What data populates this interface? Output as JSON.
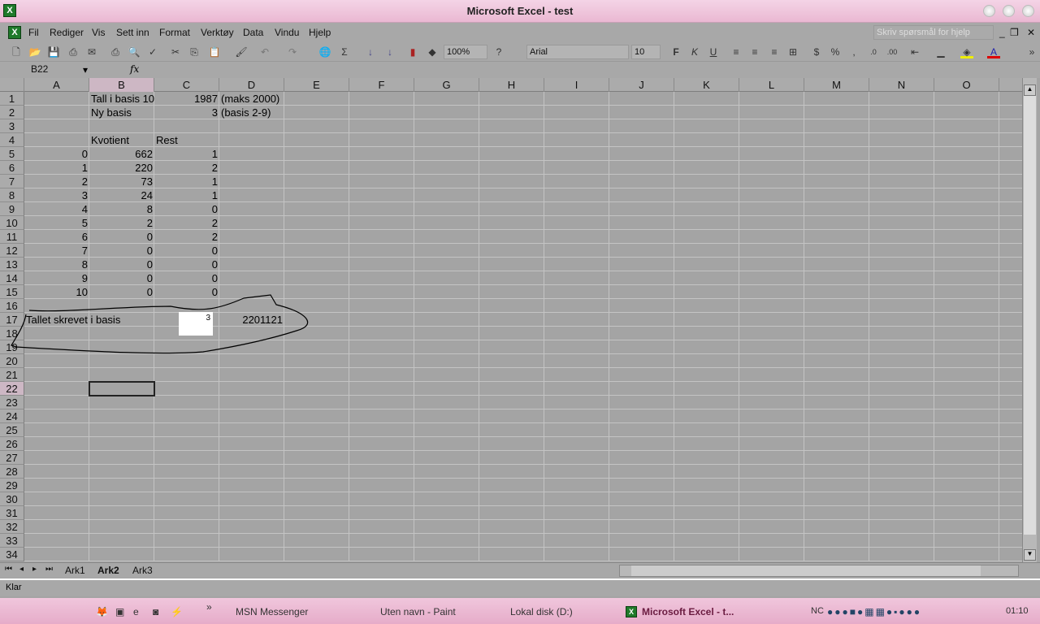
{
  "window": {
    "title": "Microsoft Excel - test"
  },
  "menu": [
    "Fil",
    "Rediger",
    "Vis",
    "Sett inn",
    "Format",
    "Verktøy",
    "Data",
    "Vindu",
    "Hjelp"
  ],
  "help_placeholder": "Skriv spørsmål for hjelp",
  "toolbar": {
    "zoom": "100%",
    "font": "Arial",
    "size": "10",
    "bold": "F",
    "italic": "K",
    "underline": "U",
    "percent": "%",
    "comma": ","
  },
  "formula": {
    "namebox": "B22",
    "fx": "fx",
    "value": ""
  },
  "columns": [
    "A",
    "B",
    "C",
    "D",
    "E",
    "F",
    "G",
    "H",
    "I",
    "J",
    "K",
    "L",
    "M",
    "N",
    "O"
  ],
  "selected_cell": "B22",
  "cells": [
    {
      "ref": "B1",
      "v": "Tall i basis 10",
      "a": "l"
    },
    {
      "ref": "C1",
      "v": "1987",
      "a": "r"
    },
    {
      "ref": "D1",
      "v": "(maks 2000)",
      "a": "l"
    },
    {
      "ref": "B2",
      "v": "Ny basis",
      "a": "l"
    },
    {
      "ref": "C2",
      "v": "3",
      "a": "r"
    },
    {
      "ref": "D2",
      "v": "(basis 2-9)",
      "a": "l"
    },
    {
      "ref": "B4",
      "v": "Kvotient",
      "a": "l"
    },
    {
      "ref": "C4",
      "v": "Rest",
      "a": "l"
    },
    {
      "ref": "A5",
      "v": "0",
      "a": "r"
    },
    {
      "ref": "B5",
      "v": "662",
      "a": "r"
    },
    {
      "ref": "C5",
      "v": "1",
      "a": "r"
    },
    {
      "ref": "A6",
      "v": "1",
      "a": "r"
    },
    {
      "ref": "B6",
      "v": "220",
      "a": "r"
    },
    {
      "ref": "C6",
      "v": "2",
      "a": "r"
    },
    {
      "ref": "A7",
      "v": "2",
      "a": "r"
    },
    {
      "ref": "B7",
      "v": "73",
      "a": "r"
    },
    {
      "ref": "C7",
      "v": "1",
      "a": "r"
    },
    {
      "ref": "A8",
      "v": "3",
      "a": "r"
    },
    {
      "ref": "B8",
      "v": "24",
      "a": "r"
    },
    {
      "ref": "C8",
      "v": "1",
      "a": "r"
    },
    {
      "ref": "A9",
      "v": "4",
      "a": "r"
    },
    {
      "ref": "B9",
      "v": "8",
      "a": "r"
    },
    {
      "ref": "C9",
      "v": "0",
      "a": "r"
    },
    {
      "ref": "A10",
      "v": "5",
      "a": "r"
    },
    {
      "ref": "B10",
      "v": "2",
      "a": "r"
    },
    {
      "ref": "C10",
      "v": "2",
      "a": "r"
    },
    {
      "ref": "A11",
      "v": "6",
      "a": "r"
    },
    {
      "ref": "B11",
      "v": "0",
      "a": "r"
    },
    {
      "ref": "C11",
      "v": "2",
      "a": "r"
    },
    {
      "ref": "A12",
      "v": "7",
      "a": "r"
    },
    {
      "ref": "B12",
      "v": "0",
      "a": "r"
    },
    {
      "ref": "C12",
      "v": "0",
      "a": "r"
    },
    {
      "ref": "A13",
      "v": "8",
      "a": "r"
    },
    {
      "ref": "B13",
      "v": "0",
      "a": "r"
    },
    {
      "ref": "C13",
      "v": "0",
      "a": "r"
    },
    {
      "ref": "A14",
      "v": "9",
      "a": "r"
    },
    {
      "ref": "B14",
      "v": "0",
      "a": "r"
    },
    {
      "ref": "C14",
      "v": "0",
      "a": "r"
    },
    {
      "ref": "A15",
      "v": "10",
      "a": "r"
    },
    {
      "ref": "B15",
      "v": "0",
      "a": "r"
    },
    {
      "ref": "C15",
      "v": "0",
      "a": "r"
    },
    {
      "ref": "A17",
      "v": "Tallet skrevet i basis",
      "a": "l"
    },
    {
      "ref": "D17",
      "v": "2201121",
      "a": "r"
    }
  ],
  "basis_box": "3",
  "sheets": [
    "Ark1",
    "Ark2",
    "Ark3"
  ],
  "active_sheet": "Ark2",
  "status": "Klar",
  "taskbar": {
    "items": [
      "MSN Messenger",
      "Uten navn - Paint",
      "Lokal disk (D:)",
      "Microsoft Excel - t..."
    ],
    "clock": "01:10",
    "tray_label": "NC"
  }
}
